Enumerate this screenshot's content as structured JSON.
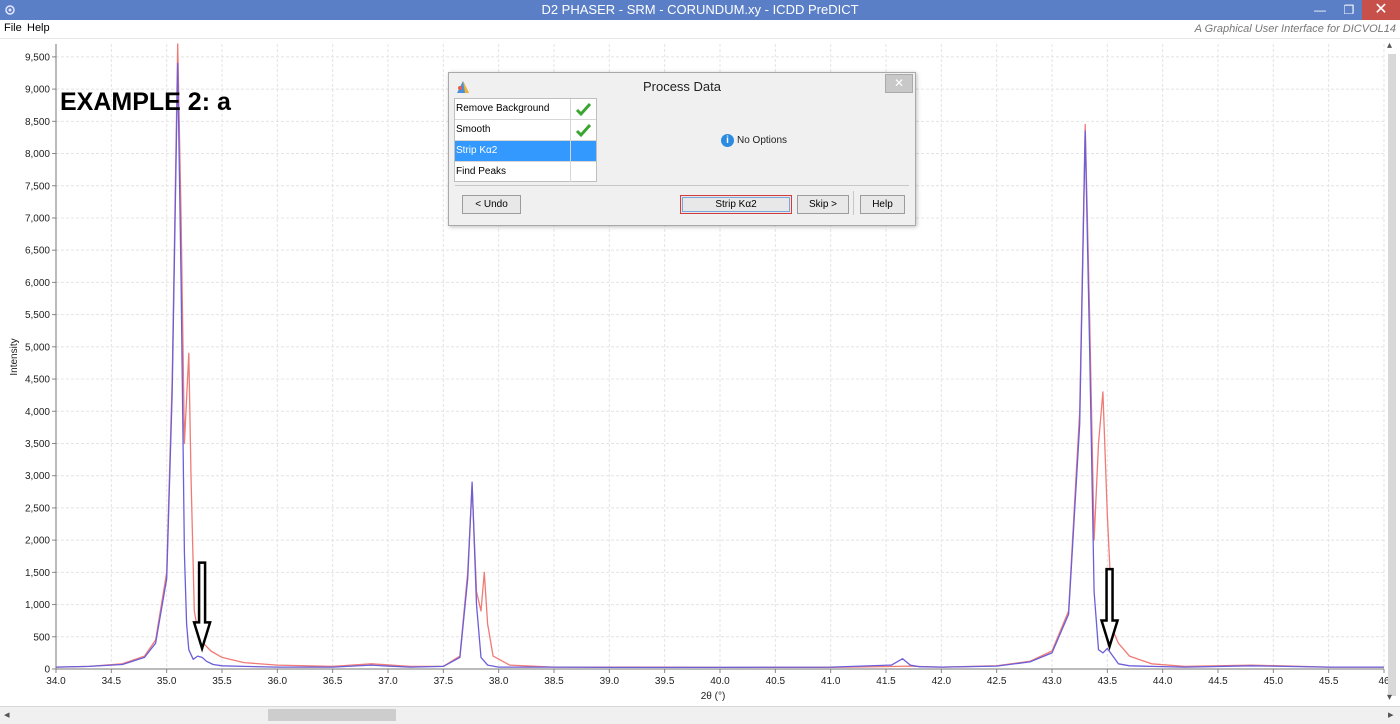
{
  "window": {
    "title": "D2 PHASER - SRM - CORUNDUM.xy - ICDD PreDICT",
    "minimize": "—",
    "maximize": "❒",
    "close": "✕"
  },
  "menu": {
    "items": [
      "File",
      "Help"
    ],
    "tagline": "A Graphical User Interface for DICVOL14"
  },
  "annotation": {
    "example_label": "EXAMPLE 2: a"
  },
  "dialog": {
    "title": "Process Data",
    "close": "✕",
    "steps": [
      {
        "label": "Remove Background",
        "done": true
      },
      {
        "label": "Smooth",
        "done": true
      },
      {
        "label": "Strip Kα2",
        "done": false,
        "selected": true
      },
      {
        "label": "Find Peaks",
        "done": false
      }
    ],
    "options_text": "No Options",
    "info_glyph": "i",
    "buttons": {
      "undo": "< Undo",
      "primary": "Strip Kα2",
      "skip": "Skip >",
      "help": "Help"
    }
  },
  "scrollbars": {
    "left_arrow": "◂",
    "right_arrow": "▸",
    "up_arrow": "▴",
    "down_arrow": "▾"
  },
  "chart_data": {
    "type": "line",
    "xlabel": "2θ (°)",
    "ylabel": "Intensity",
    "xlim": [
      34.0,
      46.0
    ],
    "ylim": [
      0,
      9700
    ],
    "x_ticks": [
      34.0,
      34.5,
      35.0,
      35.5,
      36.0,
      36.5,
      37.0,
      37.5,
      38.0,
      38.5,
      39.0,
      39.5,
      40.0,
      40.5,
      41.0,
      41.5,
      42.0,
      42.5,
      43.0,
      43.5,
      44.0,
      44.5,
      45.0,
      45.5,
      46.0
    ],
    "x_tick_labels": [
      "34.0",
      "34.5",
      "35.0",
      "35.5",
      "36.0",
      "36.5",
      "37.0",
      "37.5",
      "38.0",
      "38.5",
      "39.0",
      "39.5",
      "40.0",
      "40.5",
      "41.0",
      "41.5",
      "42.0",
      "42.5",
      "43.0",
      "43.5",
      "44.0",
      "44.5",
      "45.0",
      "45.5",
      "46"
    ],
    "y_ticks": [
      0,
      500,
      1000,
      1500,
      2000,
      2500,
      3000,
      3500,
      4000,
      4500,
      5000,
      5500,
      6000,
      6500,
      7000,
      7500,
      8000,
      8500,
      9000,
      9500
    ],
    "y_tick_labels": [
      "0",
      "500",
      "1,000",
      "1,500",
      "2,000",
      "2,500",
      "3,000",
      "3,500",
      "4,000",
      "4,500",
      "5,000",
      "5,500",
      "6,000",
      "6,500",
      "7,000",
      "7,500",
      "8,000",
      "8,500",
      "9,000",
      "9,500"
    ],
    "grid": true,
    "series": [
      {
        "color": "#f07a76",
        "x": [
          34.0,
          34.3,
          34.6,
          34.8,
          34.9,
          35.0,
          35.05,
          35.1,
          35.13,
          35.16,
          35.18,
          35.2,
          35.22,
          35.25,
          35.28,
          35.32,
          35.4,
          35.5,
          35.7,
          36.0,
          36.5,
          36.85,
          36.95,
          37.2,
          37.5,
          37.65,
          37.72,
          37.76,
          37.8,
          37.84,
          37.87,
          37.9,
          37.95,
          38.1,
          38.5,
          39.0,
          40.0,
          41.0,
          41.6,
          41.7,
          42.0,
          42.5,
          42.8,
          43.0,
          43.15,
          43.25,
          43.3,
          43.34,
          43.38,
          43.42,
          43.46,
          43.5,
          43.55,
          43.6,
          43.7,
          43.9,
          44.2,
          44.8,
          45.5,
          46.0
        ],
        "y": [
          30,
          40,
          80,
          200,
          450,
          1500,
          4500,
          9700,
          7000,
          3500,
          4200,
          4900,
          3000,
          900,
          600,
          420,
          280,
          180,
          100,
          60,
          40,
          80,
          70,
          40,
          40,
          200,
          1500,
          2850,
          1200,
          900,
          1500,
          700,
          200,
          60,
          30,
          30,
          25,
          25,
          40,
          45,
          30,
          50,
          120,
          280,
          900,
          4000,
          8450,
          5500,
          2000,
          3500,
          4300,
          2400,
          600,
          400,
          200,
          80,
          40,
          60,
          30,
          30
        ]
      },
      {
        "color": "#6b5fd8",
        "x": [
          34.0,
          34.3,
          34.6,
          34.8,
          34.9,
          35.0,
          35.05,
          35.1,
          35.13,
          35.16,
          35.18,
          35.2,
          35.24,
          35.28,
          35.32,
          35.36,
          35.42,
          35.5,
          35.7,
          36.0,
          36.5,
          36.85,
          36.95,
          37.2,
          37.5,
          37.65,
          37.72,
          37.76,
          37.8,
          37.84,
          37.9,
          38.0,
          38.5,
          39.0,
          40.0,
          41.0,
          41.55,
          41.65,
          41.72,
          41.8,
          42.0,
          42.5,
          42.8,
          43.0,
          43.15,
          43.25,
          43.3,
          43.34,
          43.38,
          43.42,
          43.46,
          43.5,
          43.55,
          43.6,
          43.7,
          43.9,
          44.2,
          44.8,
          45.5,
          46.0
        ],
        "y": [
          30,
          40,
          70,
          180,
          400,
          1400,
          4300,
          9400,
          6000,
          1800,
          700,
          300,
          150,
          200,
          180,
          120,
          70,
          50,
          40,
          30,
          30,
          60,
          50,
          30,
          40,
          180,
          1400,
          2900,
          1000,
          180,
          60,
          30,
          30,
          25,
          25,
          30,
          60,
          160,
          60,
          35,
          30,
          45,
          110,
          250,
          850,
          3800,
          8350,
          5000,
          1200,
          300,
          250,
          320,
          200,
          80,
          50,
          40,
          30,
          50,
          30,
          30
        ]
      }
    ],
    "annotations": [
      {
        "type": "down-arrow",
        "x": 35.32,
        "y_top": 1650,
        "y_bottom": 320
      },
      {
        "type": "down-arrow",
        "x": 43.52,
        "y_top": 1550,
        "y_bottom": 350
      }
    ]
  }
}
